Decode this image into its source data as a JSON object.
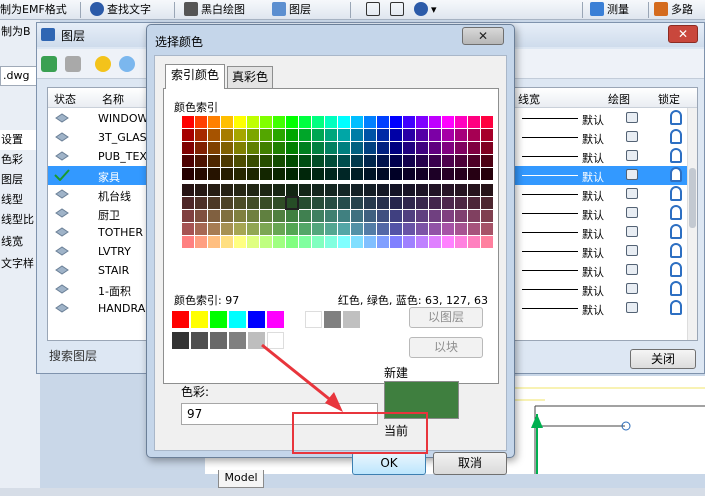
{
  "toolbar": {
    "items": [
      "制为EMF格式",
      "查找文字",
      "黑白绘图",
      "图层",
      "测量",
      "多路"
    ]
  },
  "left_strip": {
    "items": [
      "制为B",
      "设置",
      "色彩",
      "图层",
      "线型",
      "线型比",
      "线宽",
      "文字样"
    ],
    "doc_tab": ".dwg"
  },
  "layer_window": {
    "title": "图层",
    "columns": {
      "state": "状态",
      "name": "名称",
      "lineweight": "线宽",
      "print": "绘图",
      "lock": "锁定"
    },
    "rows": [
      {
        "name": "WINDOW",
        "lineweight": "默认",
        "selected": false
      },
      {
        "name": "3T_GLASS",
        "lineweight": "默认",
        "selected": false
      },
      {
        "name": "PUB_TEXT",
        "lineweight": "默认",
        "selected": false
      },
      {
        "name": "家具",
        "lineweight": "默认",
        "selected": true
      },
      {
        "name": "机台线",
        "lineweight": "默认",
        "selected": false
      },
      {
        "name": "厨卫",
        "lineweight": "默认",
        "selected": false
      },
      {
        "name": "TOTHER",
        "lineweight": "默认",
        "selected": false
      },
      {
        "name": "LVTRY",
        "lineweight": "默认",
        "selected": false
      },
      {
        "name": "STAIR",
        "lineweight": "默认",
        "selected": false
      },
      {
        "name": "1-面积",
        "lineweight": "默认",
        "selected": false
      },
      {
        "name": "HANDRAI",
        "lineweight": "默认",
        "selected": false
      }
    ],
    "search_placeholder": "搜索图层",
    "close_button": "关闭"
  },
  "model_tab": "Model",
  "dialog": {
    "title": "选择颜色",
    "close_glyph": "✕",
    "tabs": [
      {
        "label": "索引颜色",
        "active": true
      },
      {
        "label": "真彩色",
        "active": false
      }
    ],
    "index_palette_label": "颜色索引",
    "current_index_text": "颜色索引: 97",
    "current_rgb_text": "红色, 绿色, 蓝色: 63, 127, 63",
    "bylayer_button": "以图层",
    "byblock_button": "以块",
    "color_label": "色彩:",
    "color_value": "97",
    "new_label": "新建",
    "current_label": "当前",
    "new_color": "#3f7f3f",
    "ok_button": "OK",
    "cancel_button": "取消",
    "standard_colors": [
      "#ff0000",
      "#ffff00",
      "#00ff00",
      "#00ffff",
      "#0000ff",
      "#ff00ff",
      "#ffffff",
      "#808080",
      "#c0c0c0"
    ],
    "gray_shades": [
      "#333333",
      "#505050",
      "#696969",
      "#808080",
      "#bebebe",
      "#ffffff"
    ]
  }
}
